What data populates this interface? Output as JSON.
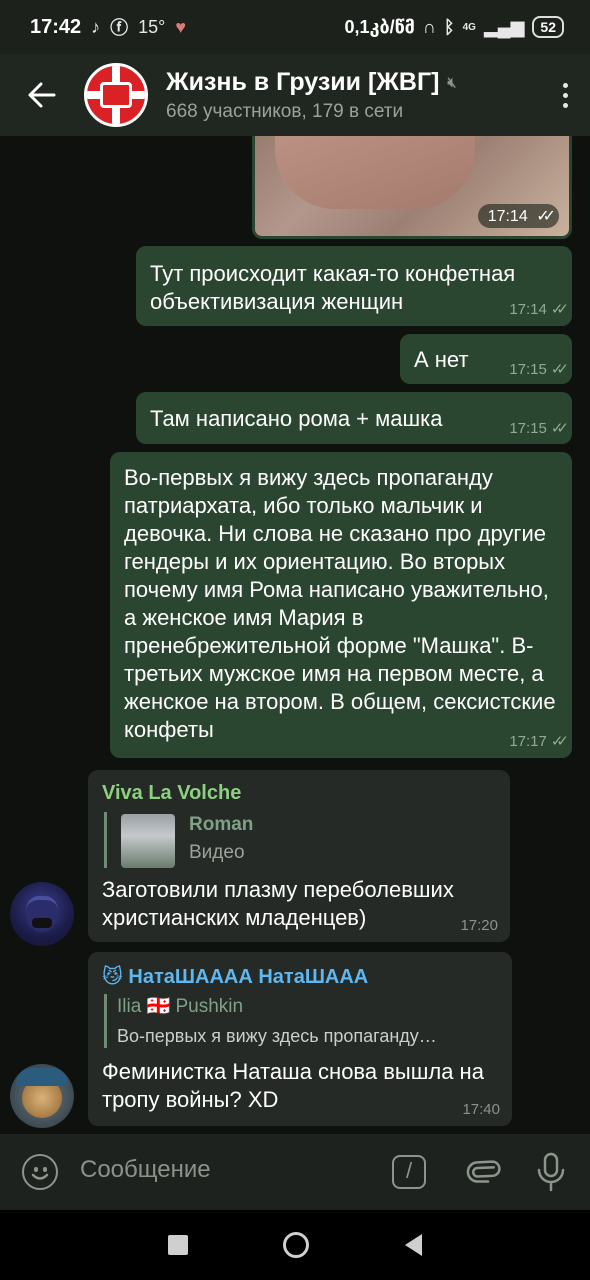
{
  "status_bar": {
    "time": "17:42",
    "temperature": "15°",
    "network_speed": "0,1‍კბ/წმ",
    "network_type": "4G",
    "battery": "52"
  },
  "header": {
    "title": "Жизнь в Грузии [ЖВГ]",
    "subtitle": "668 участников, 179 в сети"
  },
  "messages": {
    "photo_time": "17:14",
    "m1": {
      "text": "Тут происходит какая-то конфетная объективизация женщин",
      "time": "17:14"
    },
    "m2": {
      "text": "А нет",
      "time": "17:15"
    },
    "m3": {
      "text": "Там написано рома + машка",
      "time": "17:15"
    },
    "m4": {
      "text": "Во-первых я вижу здесь пропаганду патриархата, ибо только мальчик и девочка. Ни слова не сказано про другие гендеры и их ориентацию. Во вторых почему имя Рома написано уважительно, а женское имя Мария в пренебрежительной форме \"Машка\". В-третьих мужское имя на первом месте, а женское на втором. В общем, сексистские конфеты",
      "time": "17:17"
    },
    "m5": {
      "sender": "Viva La Volche",
      "reply_name": "Roman",
      "reply_text": "Видео",
      "text": "Заготовили плазму переболевших христианских младенцев)",
      "time": "17:20"
    },
    "m6": {
      "sender_emoji": "😼",
      "sender": "НатаШАААА НатаШААА",
      "reply_name": "Ilia 🇬🇪 Pushkin",
      "reply_text": "Во-первых я вижу здесь пропаганду…",
      "text": "Феминистка Наташа снова вышла на тропу войны? XD",
      "time": "17:40"
    }
  },
  "colors": {
    "sender_green": "#8bd17f",
    "sender_blue": "#5fb7f2"
  },
  "composer": {
    "placeholder": "Сообщение"
  }
}
